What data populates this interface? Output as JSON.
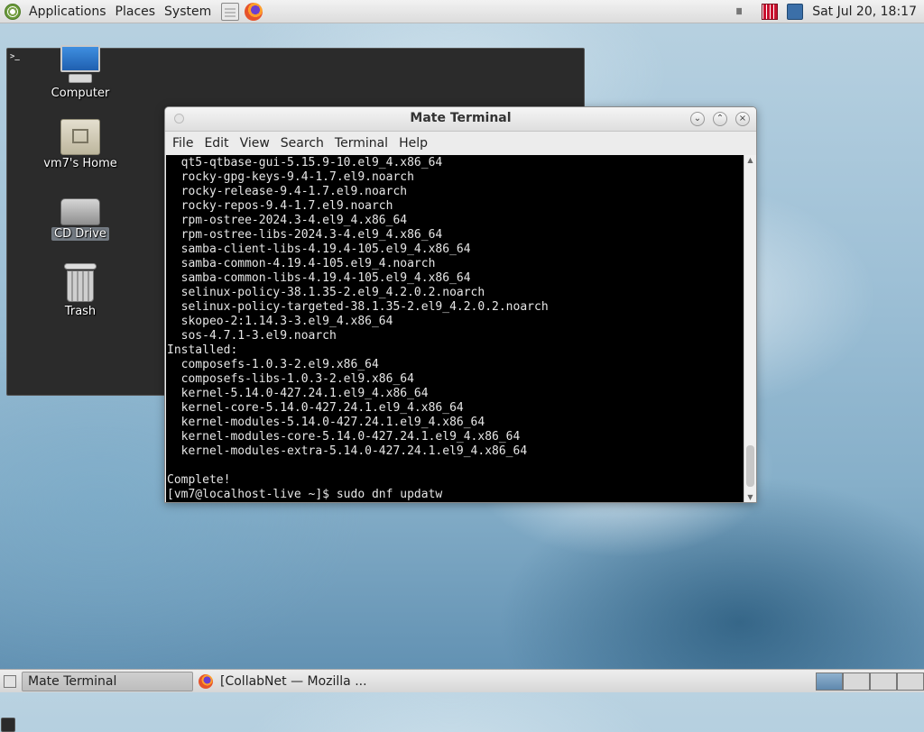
{
  "top_panel": {
    "menus": [
      "Applications",
      "Places",
      "System"
    ],
    "launchers": [
      "file-manager-icon",
      "terminal-icon",
      "firefox-icon"
    ],
    "tray": [
      "volume-icon",
      "network-icon",
      "display-icon"
    ],
    "clock": "Sat Jul 20, 18:17"
  },
  "desktop": {
    "icons": [
      {
        "label": "Computer",
        "icon": "computer-icon"
      },
      {
        "label": "vm7's Home",
        "icon": "home-folder-icon"
      },
      {
        "label": "CD Drive",
        "icon": "cd-drive-icon",
        "selected": true
      },
      {
        "label": "Trash",
        "icon": "trash-icon"
      }
    ]
  },
  "window": {
    "title": "Mate Terminal",
    "menu": [
      "File",
      "Edit",
      "View",
      "Search",
      "Terminal",
      "Help"
    ],
    "terminal_lines": [
      "  qt5-qtbase-gui-5.15.9-10.el9_4.x86_64",
      "  rocky-gpg-keys-9.4-1.7.el9.noarch",
      "  rocky-release-9.4-1.7.el9.noarch",
      "  rocky-repos-9.4-1.7.el9.noarch",
      "  rpm-ostree-2024.3-4.el9_4.x86_64",
      "  rpm-ostree-libs-2024.3-4.el9_4.x86_64",
      "  samba-client-libs-4.19.4-105.el9_4.x86_64",
      "  samba-common-4.19.4-105.el9_4.noarch",
      "  samba-common-libs-4.19.4-105.el9_4.x86_64",
      "  selinux-policy-38.1.35-2.el9_4.2.0.2.noarch",
      "  selinux-policy-targeted-38.1.35-2.el9_4.2.0.2.noarch",
      "  skopeo-2:1.14.3-3.el9_4.x86_64",
      "  sos-4.7.1-3.el9.noarch",
      "Installed:",
      "  composefs-1.0.3-2.el9.x86_64",
      "  composefs-libs-1.0.3-2.el9.x86_64",
      "  kernel-5.14.0-427.24.1.el9_4.x86_64",
      "  kernel-core-5.14.0-427.24.1.el9_4.x86_64",
      "  kernel-modules-5.14.0-427.24.1.el9_4.x86_64",
      "  kernel-modules-core-5.14.0-427.24.1.el9_4.x86_64",
      "  kernel-modules-extra-5.14.0-427.24.1.el9_4.x86_64",
      "",
      "Complete!",
      "[vm7@localhost-live ~]$ sudo dnf updatw"
    ]
  },
  "taskbar": {
    "tasks": [
      {
        "label": "Mate Terminal",
        "icon": "terminal-icon",
        "active": true
      },
      {
        "label": "[CollabNet — Mozilla ...",
        "icon": "firefox-icon",
        "active": false
      }
    ]
  }
}
